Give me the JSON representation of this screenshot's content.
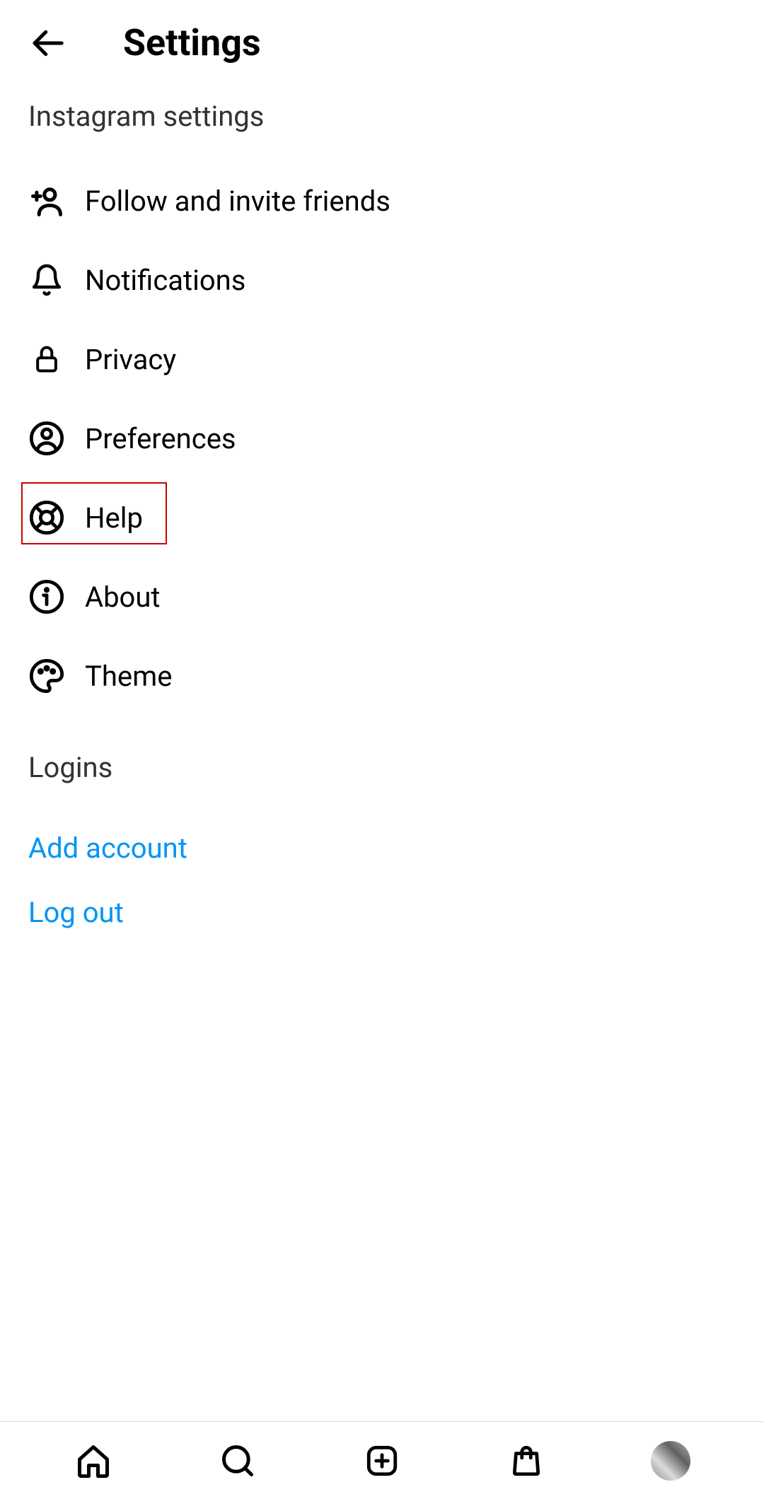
{
  "header": {
    "title": "Settings"
  },
  "section_label": "Instagram settings",
  "menu": {
    "items": [
      {
        "icon": "add-friend-icon",
        "label": "Follow and invite friends"
      },
      {
        "icon": "bell-icon",
        "label": "Notifications"
      },
      {
        "icon": "lock-icon",
        "label": "Privacy"
      },
      {
        "icon": "person-circle-icon",
        "label": "Preferences"
      },
      {
        "icon": "lifebuoy-icon",
        "label": "Help"
      },
      {
        "icon": "info-icon",
        "label": "About"
      },
      {
        "icon": "palette-icon",
        "label": "Theme"
      }
    ]
  },
  "logins": {
    "header": "Logins",
    "add_account": "Add account",
    "log_out": "Log out"
  },
  "colors": {
    "link": "#0095f6",
    "highlight": "#cc0000"
  }
}
